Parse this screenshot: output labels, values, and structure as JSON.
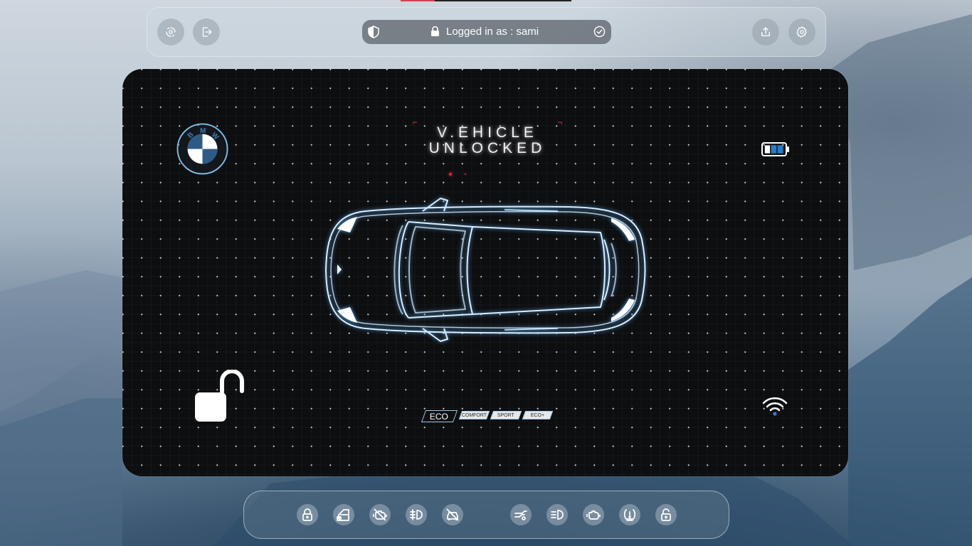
{
  "header": {
    "login_text": "Logged in as : sami",
    "icons": [
      "scan-icon",
      "logout-icon",
      "shield-icon",
      "lock-icon",
      "check-circle-icon",
      "share-icon",
      "gear-icon"
    ]
  },
  "dashboard": {
    "brand_letters": [
      "B",
      "M",
      "W"
    ],
    "status_line1": "V.EHICLE",
    "status_line2": "UNLOCKED",
    "drive_modes": [
      "ECO",
      "COMFORT",
      "SPORT",
      "ECO+"
    ],
    "active_mode": "ECO",
    "accent_color": "#8fd0ff",
    "battery_level_fraction": 0.66,
    "icons": [
      "bmw-logo",
      "battery-icon",
      "car-outline",
      "unlock-icon",
      "wifi-icon"
    ]
  },
  "controls": {
    "icons": [
      "lock-icon",
      "car-door-icon",
      "engine-off-icon",
      "fog-light-icon",
      "car-alert-icon",
      "trunk-icon",
      "headlight-icon",
      "engine-icon",
      "tire-pressure-icon",
      "unlock-icon"
    ]
  }
}
